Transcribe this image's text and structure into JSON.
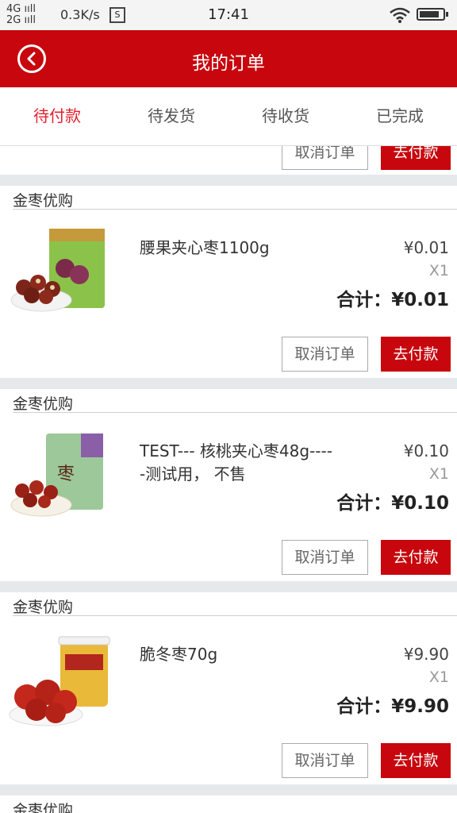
{
  "status_bar": {
    "network_top": "4G",
    "network_bottom": "2G",
    "speed": "0.3K/s",
    "s_icon": "S",
    "time": "17:41",
    "battery_level": 0.85
  },
  "header": {
    "title": "我的订单",
    "back_icon": "back-arrow-icon"
  },
  "tabs": [
    {
      "label": "待付款",
      "active": true
    },
    {
      "label": "待发货",
      "active": false
    },
    {
      "label": "待收货",
      "active": false
    },
    {
      "label": "已完成",
      "active": false
    }
  ],
  "partial_order": {
    "cancel_label": "取消订单",
    "pay_label": "去付款"
  },
  "orders": [
    {
      "store": "金枣优购",
      "product_name": "腰果夹心枣1100g",
      "price": "¥0.01",
      "qty": "X1",
      "total": "合计：¥0.01",
      "cancel_label": "取消订单",
      "pay_label": "去付款"
    },
    {
      "store": "金枣优购",
      "product_name": "TEST---  核桃夹心枣48g-----测试用， 不售",
      "price": "¥0.10",
      "qty": "X1",
      "total": "合计：¥0.10",
      "cancel_label": "取消订单",
      "pay_label": "去付款"
    },
    {
      "store": "金枣优购",
      "product_name": "脆冬枣70g",
      "price": "¥9.90",
      "qty": "X1",
      "total": "合计：¥9.90",
      "cancel_label": "取消订单",
      "pay_label": "去付款"
    }
  ],
  "next_order": {
    "store": "金枣优购"
  },
  "colors": {
    "brand_red": "#c7070d",
    "active_tab": "#e4202e"
  }
}
